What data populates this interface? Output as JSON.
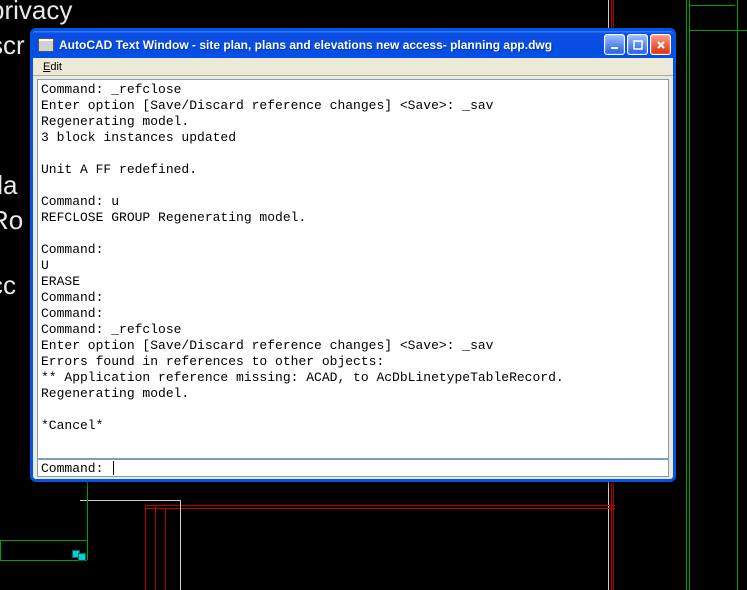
{
  "cad_background": {
    "texts": [
      "privacy",
      "scr",
      "fla",
      "Ro",
      "cc"
    ]
  },
  "window": {
    "title": "AutoCAD Text Window - site plan, plans and elevations new access- planning app.dwg",
    "menu": {
      "edit": "Edit"
    },
    "history": "Command: _refclose\nEnter option [Save/Discard reference changes] <Save>: _sav\nRegenerating model.\n3 block instances updated\n\nUnit A FF redefined.\n\nCommand: u\nREFCLOSE GROUP Regenerating model.\n\nCommand:\nU\nERASE\nCommand:\nCommand:\nCommand: _refclose\nEnter option [Save/Discard reference changes] <Save>: _sav\nErrors found in references to other objects:\n** Application reference missing: ACAD, to AcDbLinetypeTableRecord.\nRegenerating model.\n\n*Cancel*\n",
    "command_prompt": "Command: "
  }
}
